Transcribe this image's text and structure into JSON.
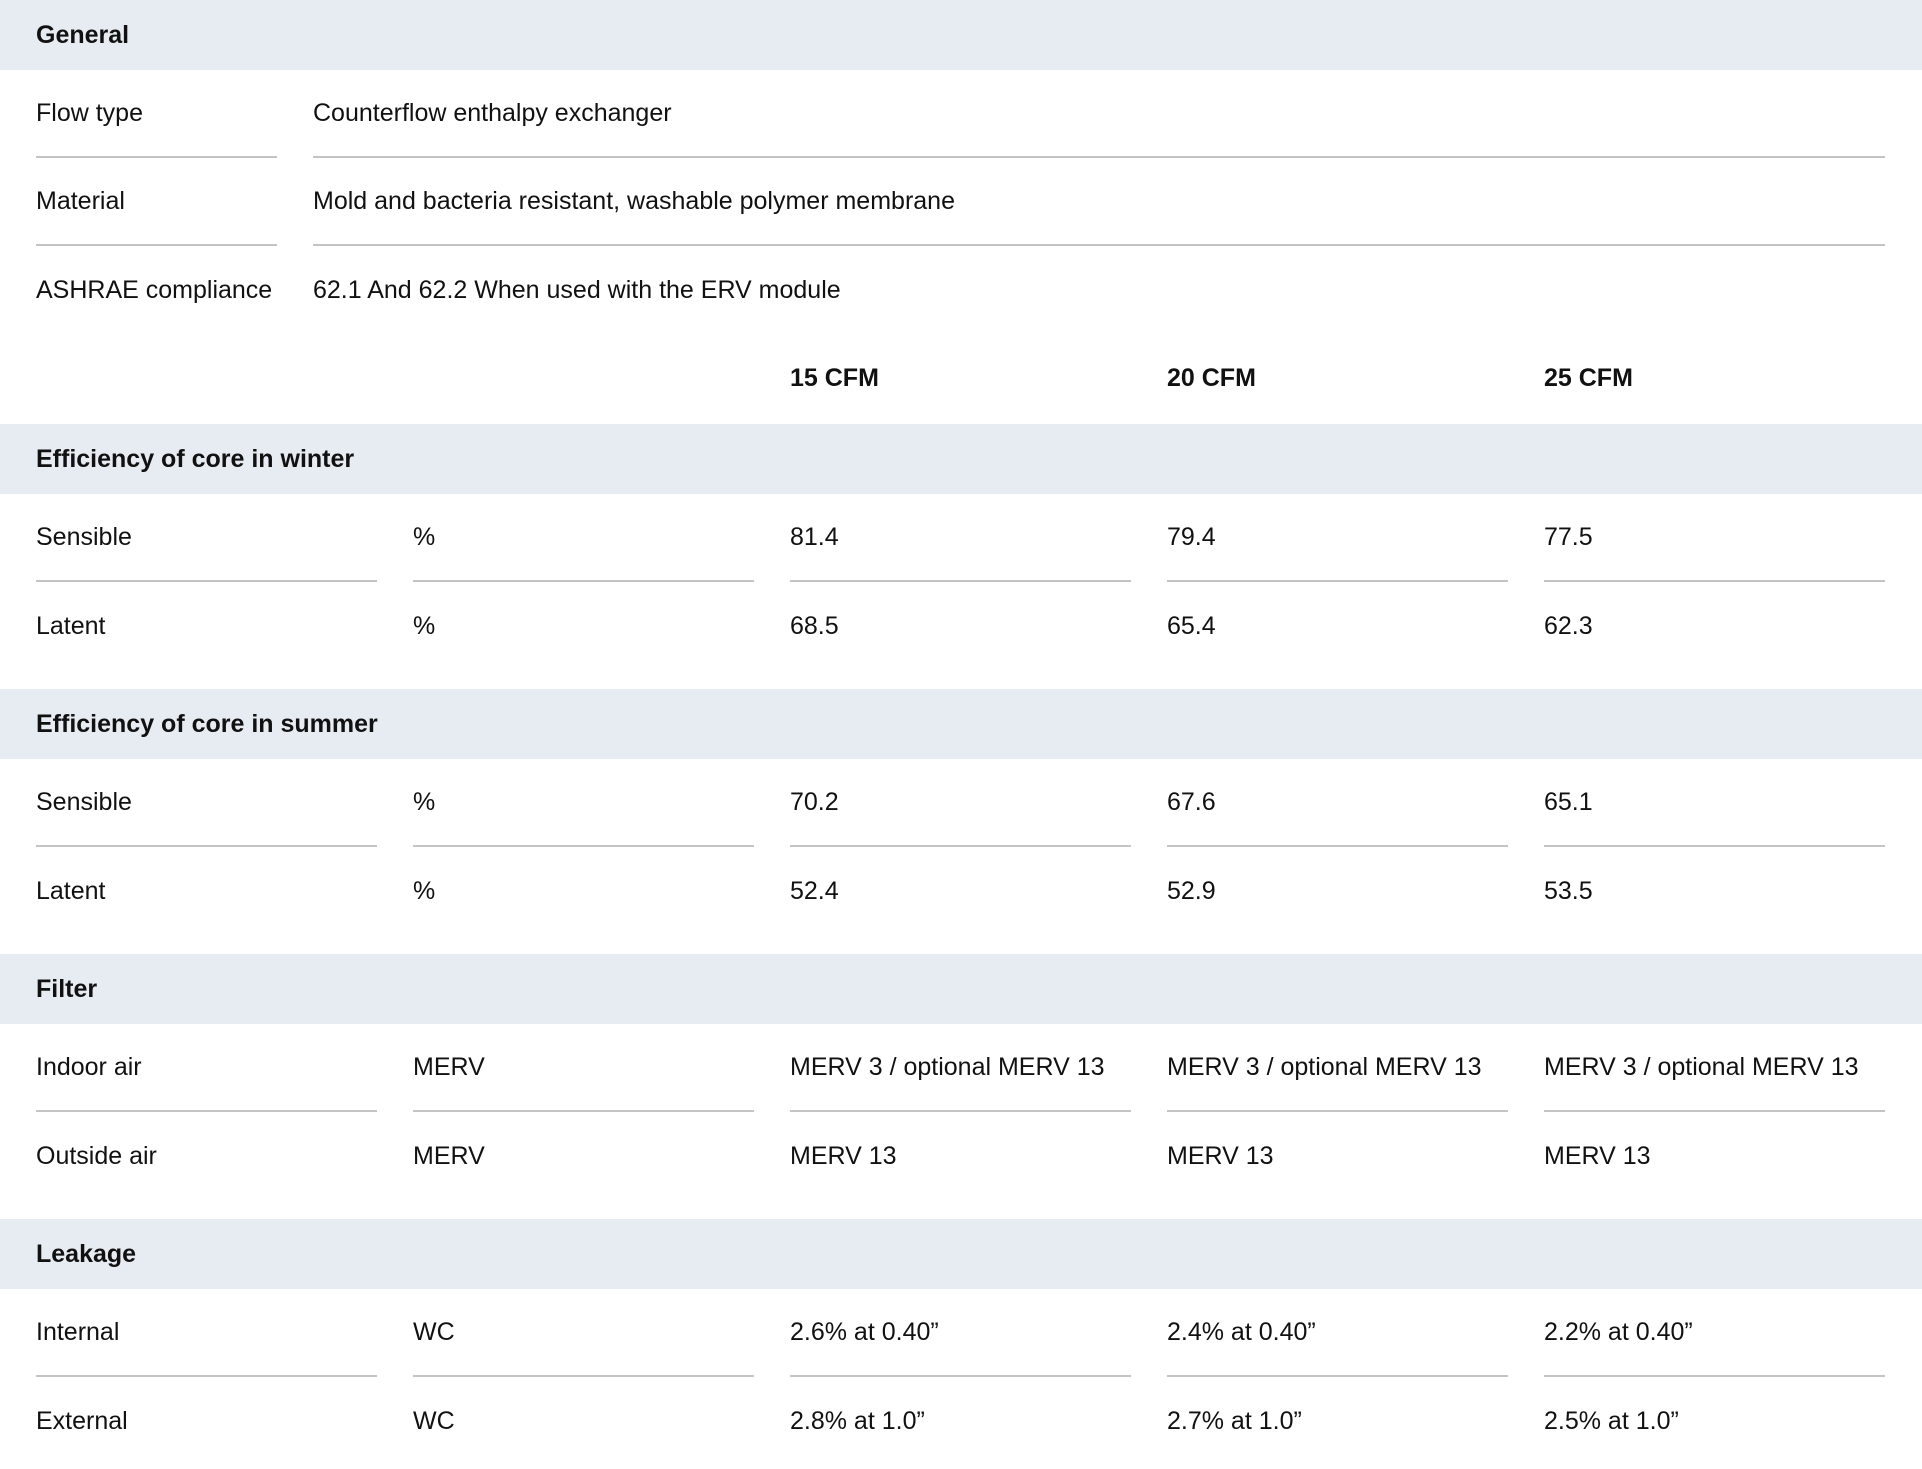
{
  "general": {
    "title": "General",
    "rows": [
      {
        "label": "Flow type",
        "value": "Counterflow enthalpy exchanger"
      },
      {
        "label": "Material",
        "value": "Mold and bacteria resistant, washable  polymer membrane"
      },
      {
        "label": "ASHRAE compliance",
        "value": "62.1 And 62.2 When used with the ERV module"
      }
    ]
  },
  "columns": [
    "15 CFM",
    "20 CFM",
    "25 CFM"
  ],
  "winter": {
    "title": "Efficiency of core in winter",
    "rows": [
      {
        "label": "Sensible",
        "unit": "%",
        "values": [
          "81.4",
          "79.4",
          "77.5"
        ]
      },
      {
        "label": "Latent",
        "unit": "%",
        "values": [
          "68.5",
          "65.4",
          "62.3"
        ]
      }
    ]
  },
  "summer": {
    "title": "Efficiency of core in summer",
    "rows": [
      {
        "label": "Sensible",
        "unit": "%",
        "values": [
          "70.2",
          "67.6",
          "65.1"
        ]
      },
      {
        "label": "Latent",
        "unit": "%",
        "values": [
          "52.4",
          "52.9",
          "53.5"
        ]
      }
    ]
  },
  "filter": {
    "title": "Filter",
    "rows": [
      {
        "label": "Indoor air",
        "unit": "MERV",
        "values": [
          "MERV 3 / optional MERV 13",
          "MERV 3 / optional MERV 13",
          "MERV 3 / optional MERV 13"
        ]
      },
      {
        "label": "Outside air",
        "unit": "MERV",
        "values": [
          "MERV 13",
          "MERV 13",
          "MERV 13"
        ]
      }
    ]
  },
  "leakage": {
    "title": "Leakage",
    "rows": [
      {
        "label": "Internal",
        "unit": "WC",
        "values": [
          "2.6% at 0.40”",
          "2.4% at 0.40”",
          "2.2% at 0.40”"
        ]
      },
      {
        "label": "External",
        "unit": "WC",
        "values": [
          "2.8% at 1.0”",
          "2.7% at 1.0”",
          "2.5% at 1.0”"
        ]
      }
    ]
  }
}
